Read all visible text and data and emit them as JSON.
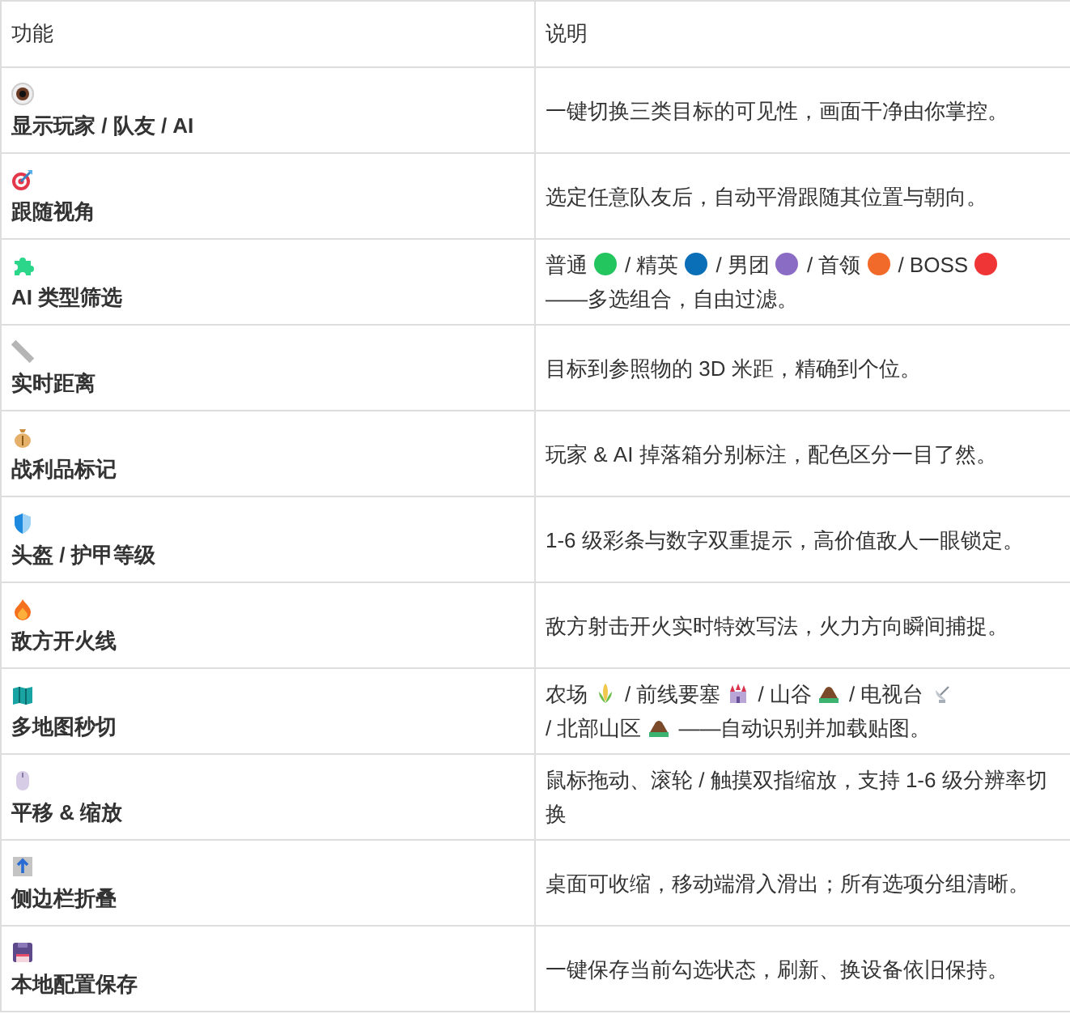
{
  "table": {
    "columns": [
      "功能",
      "说明"
    ],
    "rows": [
      {
        "name": "显示玩家 / 队友 / AI",
        "description": "一键切换三类目标的可见性，画面干净由你掌控。"
      },
      {
        "name": "跟随视角",
        "description": "选定任意队友后，自动平滑跟随其位置与朝向。"
      },
      {
        "name": "AI 类型筛选",
        "segments": [
          {
            "kind": "text",
            "text": "普通"
          },
          {
            "kind": "dot",
            "color": "#22c55e"
          },
          {
            "kind": "text",
            "text": "/ 精英"
          },
          {
            "kind": "dot",
            "color": "#0b6fb8"
          },
          {
            "kind": "text",
            "text": "/ 男团"
          },
          {
            "kind": "dot",
            "color": "#8b6cc4"
          },
          {
            "kind": "text",
            "text": "/ 首领"
          },
          {
            "kind": "dot",
            "color": "#f26a2a"
          },
          {
            "kind": "text",
            "text": "/ BOSS"
          },
          {
            "kind": "dot",
            "color": "#ef3535"
          },
          {
            "kind": "text",
            "text": "——多选组合，自由过滤。"
          }
        ]
      },
      {
        "name": "实时距离",
        "description": "目标到参照物的 3D 米距，精确到个位。"
      },
      {
        "name": "战利品标记",
        "description": "玩家 & AI 掉落箱分别标注，配色区分一目了然。"
      },
      {
        "name": "头盔 / 护甲等级",
        "description": "1-6 级彩条与数字双重提示，高价值敌人一眼锁定。"
      },
      {
        "name": "敌方开火线",
        "description": "敌方射击开火实时特效写法，火力方向瞬间捕捉。"
      },
      {
        "name": "多地图秒切",
        "segments": [
          {
            "kind": "text",
            "text": "农场"
          },
          {
            "kind": "icon"
          },
          {
            "kind": "text",
            "text": "/ 前线要塞"
          },
          {
            "kind": "icon"
          },
          {
            "kind": "text",
            "text": "/ 山谷"
          },
          {
            "kind": "icon"
          },
          {
            "kind": "text",
            "text": "/ 电视台"
          },
          {
            "kind": "icon"
          },
          {
            "kind": "text",
            "text": "/ 北部山区"
          },
          {
            "kind": "icon"
          },
          {
            "kind": "text",
            "text": "——自动识别并加载贴图。"
          }
        ]
      },
      {
        "name": "平移 & 缩放",
        "description": "鼠标拖动、滚轮 / 触摸双指缩放，支持 1-6 级分辨率切换"
      },
      {
        "name": "侧边栏折叠",
        "description": "桌面可收缩，移动端滑入滑出；所有选项分组清晰。"
      },
      {
        "name": "本地配置保存",
        "description": "一键保存当前勾选状态，刷新、换设备依旧保持。"
      }
    ]
  }
}
